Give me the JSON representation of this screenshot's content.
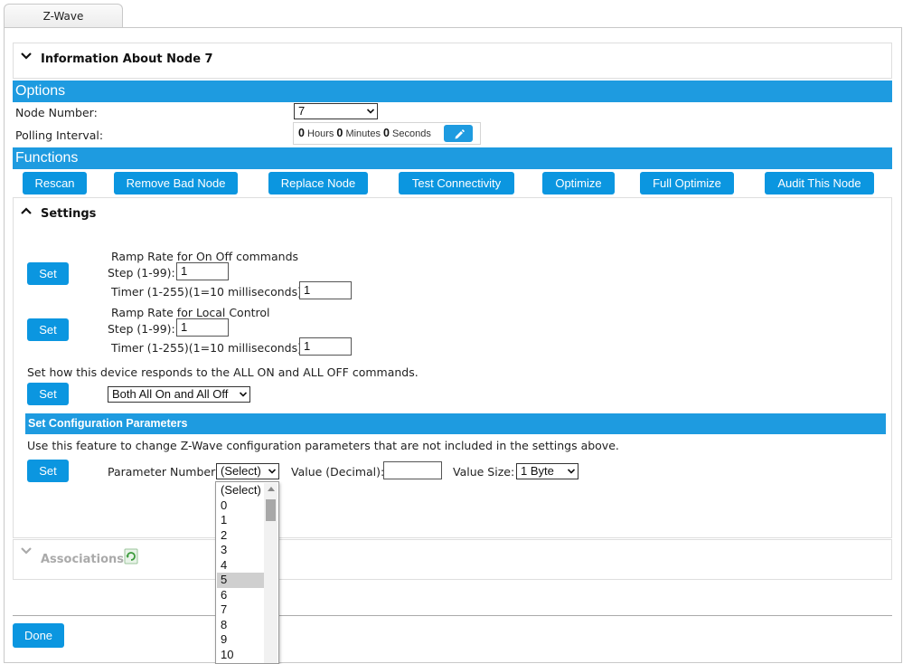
{
  "tab": {
    "label": "Z-Wave"
  },
  "info_panel": {
    "title": "Information About Node 7"
  },
  "options": {
    "header": "Options",
    "node_number_label": "Node Number:",
    "node_number_value": "7",
    "polling_label": "Polling Interval:",
    "polling": {
      "hours_value": "0",
      "hours_label": "Hours",
      "minutes_value": "0",
      "minutes_label": "Minutes",
      "seconds_value": "0",
      "seconds_label": "Seconds"
    }
  },
  "functions": {
    "header": "Functions",
    "buttons": [
      "Rescan",
      "Remove Bad Node",
      "Replace Node",
      "Test Connectivity",
      "Optimize",
      "Full Optimize",
      "Audit This Node"
    ]
  },
  "settings": {
    "title": "Settings",
    "set_label": "Set",
    "ramp_on_off": {
      "title": "Ramp Rate for On Off commands",
      "step_label": "Step (1-99):",
      "step_value": "1",
      "timer_label": "Timer (1-255)(1=10 milliseconds):",
      "timer_value": "1"
    },
    "ramp_local": {
      "title": "Ramp Rate for Local Control",
      "step_label": "Step (1-99):",
      "step_value": "1",
      "timer_label": "Timer (1-255)(1=10 milliseconds):",
      "timer_value": "1"
    },
    "all_on_off": {
      "text": "Set how this device responds to the ALL ON and ALL OFF commands.",
      "value": "Both All On and All Off"
    },
    "config": {
      "header": "Set Configuration Parameters",
      "description": "Use this feature to change Z-Wave configuration parameters that are not included in the settings above.",
      "param_label": "Parameter Number:",
      "param_value": "(Select)",
      "value_label": "Value (Decimal):",
      "value_value": "",
      "size_label": "Value Size:",
      "size_value": "1 Byte"
    }
  },
  "param_dropdown": {
    "options": [
      "(Select)",
      "0",
      "1",
      "2",
      "3",
      "4",
      "5",
      "6",
      "7",
      "8",
      "9",
      "10"
    ],
    "highlighted": "5"
  },
  "associations": {
    "title": "Associations"
  },
  "done_label": "Done",
  "colors": {
    "accent": "#1e9be0",
    "button": "#0b96e0"
  }
}
